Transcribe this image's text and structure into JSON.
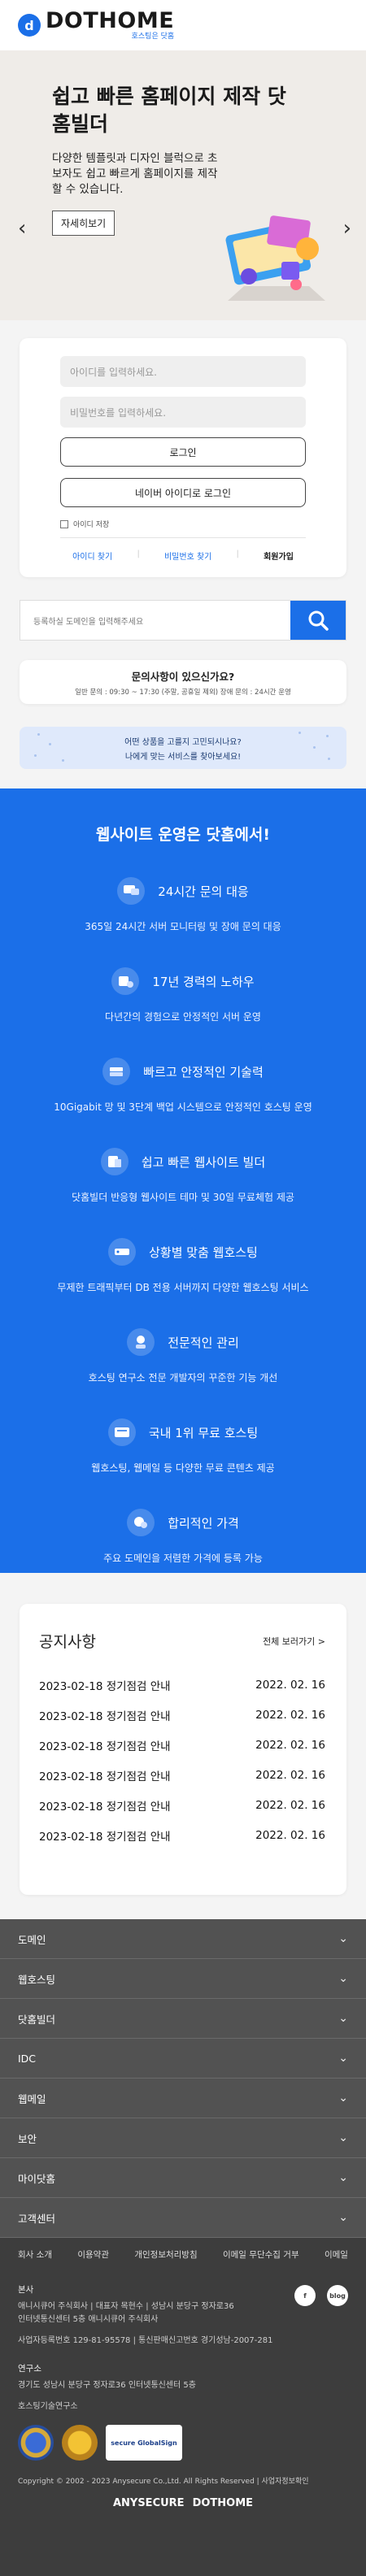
{
  "header": {
    "logo_mark": "d",
    "logo_name": "DOTHOME",
    "logo_sub": "호스팅은 닷홈"
  },
  "hero": {
    "title": "쉽고 빠른 홈페이지 제작 닷홈빌더",
    "description": "다양한 템플릿과 디자인 블럭으로 초보자도 쉽고 빠르게 홈페이지를 제작할 수 있습니다.",
    "button": "자세히보기",
    "prev": "‹",
    "next": "›"
  },
  "login": {
    "id_placeholder": "아이디를 입력하세요.",
    "pw_placeholder": "비밀번호를 입력하세요.",
    "login_button": "로그인",
    "naver_button": "네이버 아이디로 로그인",
    "keep_login": "아이디 저장",
    "links": [
      "아이디 찾기",
      "비밀번호 찾기",
      "회원가입"
    ]
  },
  "search": {
    "placeholder": "등록하실 도메인을 입력해주세요"
  },
  "help": {
    "title": "문의사항이 있으신가요?",
    "hours": "일반 문의 : 09:30 ~ 17:30 (주말, 공휴일 제외) 장애 문의 : 24시간 운영"
  },
  "recommend": {
    "line1": "어떤 상품을 고를지 고민되시나요?",
    "line2": "나에게 맞는 서비스를 찾아보세요!"
  },
  "features": {
    "title": "웹사이트 운영은 닷홈에서!",
    "items": [
      {
        "title": "24시간 문의 대응",
        "desc": "365일 24시간 서버 모니터링 및 장애 문의 대응",
        "icon": "chat-icon"
      },
      {
        "title": "17년 경력의 노하우",
        "desc": "다년간의 경험으로 안정적인 서버 운영",
        "icon": "career-icon"
      },
      {
        "title": "빠르고 안정적인 기술력",
        "desc": "10Gigabit 망 및 3단계 백업 시스템으로 안정적인 호스팅 운영",
        "icon": "server-icon"
      },
      {
        "title": "쉽고 빠른 웹사이트 빌더",
        "desc": "닷홈빌더 반응형 웹사이트 테마 및 30일 무료체험 제공",
        "icon": "builder-icon"
      },
      {
        "title": "상황별 맞춤 웹호스팅",
        "desc": "무제한 트래픽부터 DB 전용 서버까지 다양한 웹호스팅 서비스",
        "icon": "hosting-icon"
      },
      {
        "title": "전문적인 관리",
        "desc": "호스팅 연구소 전문 개발자의 꾸준한 기능 개선",
        "icon": "manager-icon"
      },
      {
        "title": "국내 1위 무료 호스팅",
        "desc": "웹호스팅, 웹메일 등 다양한 무료 콘텐츠 제공",
        "icon": "free-icon"
      },
      {
        "title": "합리적인 가격",
        "desc": "주요 도메인을 저렴한 가격에 등록 가능",
        "icon": "price-icon"
      }
    ]
  },
  "notice": {
    "title": "공지사항",
    "more": "전체 보러가기 >",
    "rows": [
      {
        "subject": "2023-02-18 정기점검 안내",
        "date": "2022. 02. 16"
      },
      {
        "subject": "2023-02-18 정기점검 안내",
        "date": "2022. 02. 16"
      },
      {
        "subject": "2023-02-18 정기점검 안내",
        "date": "2022. 02. 16"
      },
      {
        "subject": "2023-02-18 정기점검 안내",
        "date": "2022. 02. 16"
      },
      {
        "subject": "2023-02-18 정기점검 안내",
        "date": "2022. 02. 16"
      },
      {
        "subject": "2023-02-18 정기점검 안내",
        "date": "2022. 02. 16"
      }
    ]
  },
  "footer_menu": [
    "도메인",
    "웹호스팅",
    "닷홈빌더",
    "IDC",
    "웹메일",
    "보안",
    "마이닷홈",
    "고객센터"
  ],
  "footer_links": [
    "회사 소개",
    "이용약관",
    "개인정보처리방침",
    "이메일 무단수집 거부",
    "이메일"
  ],
  "footer_info": {
    "hq_label": "본사",
    "hq_lines": [
      "애니시큐어 주식회사 | 대표자 목현수 | 성남시 분당구 정자로36",
      "인터넷통신센터 5층 애니시큐어 주식회사",
      "사업자등록번호 129-81-95578 | 통신판매신고번호 경기성남-2007-281"
    ],
    "lab_label": "연구소",
    "lab_lines": [
      "경기도 성남시 분당구 정자로36 인터넷통신센터 5층"
    ],
    "lab_name": "호스팅기술연구소",
    "social": [
      "f",
      "blog"
    ],
    "badge_secure": "secure GlobalSign",
    "copyright": "Copyright © 2002 - 2023 Anysecure Co.,Ltd. All Rights Reserved | 사업자정보확인",
    "brand_left": "ANYSECURE",
    "brand_right": "DOTHOME"
  }
}
